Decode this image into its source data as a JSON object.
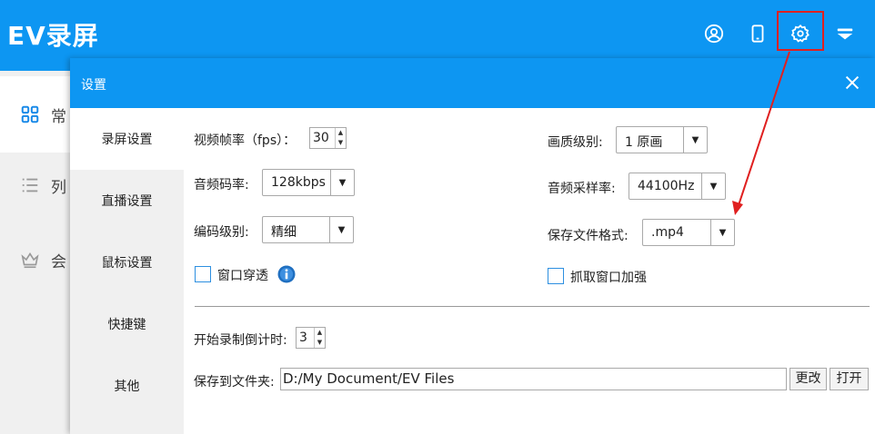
{
  "app": {
    "title": "EV录屏",
    "accent": "#0d96f2",
    "sidebar": [
      {
        "label": "常",
        "icon": "grid-icon"
      },
      {
        "label": "列",
        "icon": "list-icon"
      },
      {
        "label": "会",
        "icon": "crown-icon"
      }
    ],
    "top_icons": [
      "user-icon",
      "phone-icon",
      "gear-icon",
      "dropdown-menu-icon"
    ]
  },
  "dialog": {
    "title": "设置",
    "nav": [
      "录屏设置",
      "直播设置",
      "鼠标设置",
      "快捷键",
      "其他"
    ],
    "fps_label": "视频帧率（fps）：",
    "fps_value": "30",
    "audio_bitrate_label": "音频码率:",
    "audio_bitrate_value": "128kbps",
    "encode_level_label": "编码级别:",
    "encode_level_value": "精细",
    "window_through_label": "窗口穿透",
    "quality_label": "画质级别:",
    "quality_value": "1 原画",
    "sample_rate_label": "音频采样率:",
    "sample_rate_value": "44100Hz",
    "file_format_label": "保存文件格式:",
    "file_format_value": ".mp4",
    "capture_enhance_label": "抓取窗口加强",
    "countdown_label": "开始录制倒计时:",
    "countdown_value": "3",
    "save_folder_label": "保存到文件夹:",
    "save_folder_value": "D:/My Document/EV Files",
    "change_button": "更改",
    "open_button": "打开"
  }
}
